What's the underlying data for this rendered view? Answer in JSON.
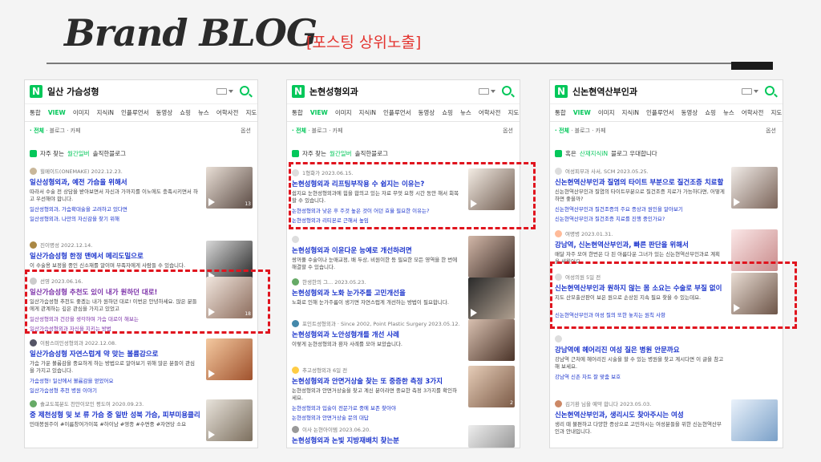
{
  "header": {
    "title": "Brand BLOG",
    "subtitle": "[포스팅 상위노출]"
  },
  "colors": {
    "accent": "#e3342f",
    "naver_green": "#03c75a",
    "link_blue": "#1a33cc",
    "visited_purple": "#7b2fa8"
  },
  "panels": [
    {
      "query": "일산 가슴성형",
      "tabs": [
        "통합",
        "VIEW",
        "이미지",
        "지식iN",
        "인플루언서",
        "동영상",
        "쇼핑",
        "뉴스",
        "어학사전",
        "지도"
      ],
      "filter": {
        "all": "· 전체",
        "blog": "· 블로그",
        "cafe": "· 카페"
      },
      "option": "옵션",
      "section": {
        "pre": "자주 찾는",
        "highlight": "월간일버",
        "post": "솔직한블로그"
      },
      "posts": [
        {
          "meta": "힐메이드(ONEMAKE)   2022.12.23.",
          "title": "일산성형외과, 예전 가슴을 위해서",
          "desc": "따라서 수술 전 상담을 받아보면서 자신과 가까지를 이노에도 충족시키면서 하고 우선해야 합니다.",
          "tag": "일산성형외과, 가슴확대술을 고려하고 있다면",
          "tag2": "일산성형외과, 나만의 자신감을 찾기 위해",
          "count": "13"
        },
        {
          "meta": "진이명성   2022.12.14.",
          "title": "일산가슴성형 한정 맨에서 메리도밀으로",
          "desc": "이 수술용 보정을 중인 신소재를 알이며 부족자에게 사람들 수 있습니다.",
          "tag": "",
          "tag2": "",
          "count": ""
        },
        {
          "meta": "선영   2023.06.16.",
          "title": "일산가슴성형 추천도 있이 내가 원하던 대로!",
          "desc": "일산가슴성형 추천도 좋겠는 내가 원하던 대로! 이번은 안녕하세요. 많은 분들에게 관계하는 깊은 관심을 가지고 있었고",
          "tag": "일산성형외과 건강을 생각하며 가슴 대로이 해보는",
          "tag2": "일산가슴성형외과 자신을 지키는 방법",
          "count": "18"
        },
        {
          "meta": "이팜스미인성형외과   2022.12.08.",
          "title": "일산가슴성형 자연스럽게 약 맞는 볼륨감으로",
          "desc": "가슴 가운 볼륨감을 중요하게 하는 방법으로 알아보기 위해 많은 분들이 관심을 가지고 있습니다.",
          "tag": "가슴성형! 일산에서 볼륨감을 얻었어요",
          "tag2": "일산가슴성형 추천 병원 이야기",
          "count": ""
        },
        {
          "meta": "솔교도복분도 천안이모인 평도여   2020.09.23.",
          "title": "중 제천성형 및 보 류 가슴 중 일반 성북 가슴, 피부미용클리니 운..",
          "desc": "민태봉원주이 #이름창여가이목 #하이남 #영종 #수면중 #자연당 소요",
          "tag": "",
          "tag2": "",
          "count": ""
        }
      ]
    },
    {
      "query": "논현성형외과",
      "tabs": [
        "통합",
        "VIEW",
        "이미지",
        "지식iN",
        "인플루언서",
        "동영상",
        "쇼핑",
        "뉴스",
        "어학사전",
        "지도"
      ],
      "filter": {
        "all": "· 전체",
        "blog": "· 블로그",
        "cafe": "· 카페"
      },
      "option": "옵션",
      "section": {
        "pre": "자주 찾는",
        "highlight": "월간일버",
        "post": "솔직한블로그"
      },
      "posts": [
        {
          "meta": "1형화가   2023.06.15.",
          "title": "논현성형외과 리프팅부작용 수 쉽지는 이유는?",
          "desc": "쉽지요 눈현성형외과에 힘을 합의고 있는 자료 무엇 요청 시간 동안 해서 회복할 수 있습니다.",
          "tag": "논현성형외과 낮은 후 주것 높은 것이 어던 효율 필요한 이유는?",
          "tag2": "논현성형외과 리티본로 근해서 높임",
          "count": ""
        },
        {
          "meta": "",
          "title": "논현성형외과 이윤다운 능예로 개선하려면",
          "desc": "쌍꺼풀 수술이나 눈매교정, 배 두상, 비원이한 등 필요한 모든 영역을 한 번에 해결할 수 있습니다.",
          "tag": "",
          "tag2": "",
          "count": ""
        },
        {
          "meta": "한생한의 그...   2023.05.23.",
          "title": "논현성형외과 노화 눈가주를 고민개선을",
          "desc": "노화로 인해 눈가주름이 생기면 자연스럽게 개선하는 방법이 필요합니다.",
          "tag": "",
          "tag2": "",
          "count": ""
        },
        {
          "meta": "포인트성형외과 · Since 2002, Point Plastic Surgery   2023.05.12.",
          "title": "논현성형외과 노안성형개를 개선 사례",
          "desc": "이렇게 논현성형외과 환자 사례를 모아 보았습니다.",
          "tag": "",
          "tag2": "",
          "count": ""
        },
        {
          "meta": "추고성형외과   6일 전",
          "title": "논현성형외과 안면거상술 찾는 또 중증한 측정 3가지",
          "desc": "논현성형외과 안면거상술을 찾고 계신 분이라면 중요한 측정 3가지를 확인하세요.",
          "tag": "논현성형외과 입술이 전문가로 중에 보존 찾아야",
          "tag2": "논현성형외과 안면거상술 문의 대답",
          "count": "2"
        },
        {
          "meta": "이사 논현아이템   2023.06.20.",
          "title": "논현성형외과 논빛 지방재배치 찾는분",
          "desc": "",
          "tag": "",
          "tag2": "",
          "count": ""
        }
      ]
    },
    {
      "query": "신논현역산부인과",
      "tabs": [
        "통합",
        "VIEW",
        "이미지",
        "지식iN",
        "인플루언서",
        "동영상",
        "쇼핑",
        "뉴스",
        "어학사전",
        "지도"
      ],
      "filter": {
        "all": "· 전체",
        "blog": "· 블로그",
        "cafe": "· 카페"
      },
      "option": "옵션",
      "section": {
        "pre": "혹은",
        "highlight": "산재지식iN",
        "post": "블로그 우대합니다"
      },
      "posts": [
        {
          "meta": "여성피부과 사서, SCM   2023.05.25.",
          "title": "신논현역산부인과 질염의 타이트 부분으로 질건조증 치료할 수 있다면",
          "desc": "신논현역산부인과 질염의 타이트부분으로 질건조증 치료가 가능하다면, 어떻게 하면 좋을까?",
          "tag": "신논현역산부인과 질건조증의 주요 증상과 원인을 알아보기",
          "tag2": "신논현역산부인과 질건조증 치료를 진행 중인가요?",
          "count": ""
        },
        {
          "meta": "여명병   2023.01.31.",
          "title": "강남역, 신논현역산부인과, 빠른 판단을 위해서",
          "desc": "매달 자주 모여 한번은 다 된 아름다운 그녀가 있는 신논현역산부인과로 계획을 세웠어요.",
          "tag": "",
          "tag2": "",
          "count": ""
        },
        {
          "meta": "여성의원   5일 전",
          "title": "신논현역산부인과 원하지 않는 몸 소요는 수술로 부질 없이",
          "desc": "지도 산모출산판이 보은 원으로 손상된 지속 필요 찾을 수 있는데요.",
          "tag": "신논현역산부인과 여성 질의 또한 놓치는 원칙 사항",
          "tag2": "",
          "count": ""
        },
        {
          "meta": "",
          "title": "강남역에 헤어리진 여성 질은 병원 안문까요",
          "desc": "강남역 근처에 헤어리진 시술을 할 수 있는 병원을 찾고 계시다면 이 글을 참고해 보세요.",
          "tag": "강남역 신촌 차트 잘 맞춤 보호",
          "tag2": "",
          "count": ""
        },
        {
          "meta": "김기환 님을 예약 합니다   2023.05.03.",
          "title": "신논현역산부인과, 생리시도 찾아주시는 여성",
          "desc": "생리 때 불편하고 다양한 증상으로 고민하시는 여성분들을 위한 신논현역산부인과 안내입니다.",
          "tag": "",
          "tag2": "",
          "count": ""
        }
      ]
    }
  ]
}
